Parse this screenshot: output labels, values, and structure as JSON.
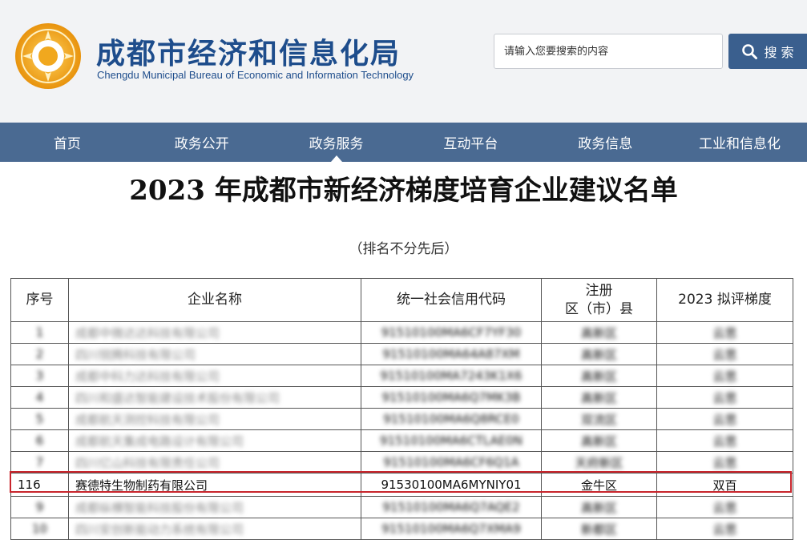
{
  "header": {
    "title_cn": "成都市经济和信息化局",
    "title_en": "Chengdu Municipal Bureau of Economic and Information Technology",
    "logo_icon": "sun-emblem-icon",
    "brand_color": "#1e4d8c",
    "logo_color": "#f1a81e"
  },
  "search": {
    "placeholder": "请输入您要搜索的内容",
    "button_label": "搜 索",
    "icon": "search-icon"
  },
  "nav": {
    "items": [
      "首页",
      "政务公开",
      "政务服务",
      "互动平台",
      "政务信息",
      "工业和信息化"
    ],
    "active_index": 2,
    "bg_color": "#4a6a92"
  },
  "document": {
    "title": "2023 年成都市新经济梯度培育企业建议名单",
    "subtitle": "（排名不分先后）"
  },
  "table": {
    "headers": {
      "index": "序号",
      "name": "企业名称",
      "code": "统一社会信用代码",
      "district_line1": "注册",
      "district_line2": "区（市）县",
      "level": "2023 拟评梯度"
    },
    "blurred_rows": [
      {
        "index": "1",
        "name": "成都中微达达科技有限公司",
        "code": "91510100MA6CF7YF30",
        "district": "高新区",
        "level": "云思"
      },
      {
        "index": "2",
        "name": "四川锐腾科技有限公司",
        "code": "91510100MA64A87XM",
        "district": "高新区",
        "level": "云思"
      },
      {
        "index": "3",
        "name": "成都中科力达科技有限公司",
        "code": "91510100MA7243K1X6",
        "district": "高新区",
        "level": "云思"
      },
      {
        "index": "4",
        "name": "四川和盛达智能建设技术股份有限公司",
        "code": "91510100MA6Q7MK3B",
        "district": "高新区",
        "level": "云思"
      },
      {
        "index": "5",
        "name": "成都航天测控科技有限公司",
        "code": "91510100MA6Q8RCE0",
        "district": "双流区",
        "level": "云思"
      },
      {
        "index": "6",
        "name": "成都航天集成电路设计有限公司",
        "code": "91510100MA6CTLAE0N",
        "district": "高新区",
        "level": "云思"
      },
      {
        "index": "7",
        "name": "四川亿山科技有限责任公司",
        "code": "91510100MA6CF6Q1A",
        "district": "天府新区",
        "level": "云思"
      }
    ],
    "highlight_row": {
      "index": "116",
      "name": "赛德特生物制药有限公司",
      "code": "91530100MA6MYNIY01",
      "district": "金牛区",
      "level": "双百"
    },
    "blurred_rows_after": [
      {
        "index": "9",
        "name": "成都纵横智能科技股份有限公司",
        "code": "91510100MA6Q7AQE2",
        "district": "高新区",
        "level": "云思"
      },
      {
        "index": "10",
        "name": "四川安创新能动力系统有限公司",
        "code": "91510100MA6Q7XMA9",
        "district": "新都区",
        "level": "云思"
      }
    ],
    "highlight_color": "#c8252c"
  }
}
